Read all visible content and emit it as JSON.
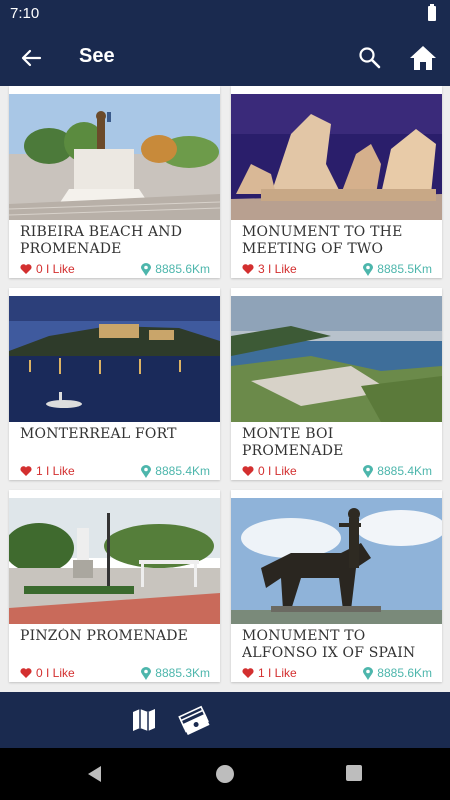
{
  "status_bar": {
    "time": "7:10"
  },
  "app_bar": {
    "title": "See",
    "back_icon": "arrow-back-icon",
    "search_icon": "search-icon",
    "home_icon": "home-icon"
  },
  "cards": [
    {
      "title": "RIBEIRA BEACH AND PROMENADE",
      "likes": "0 I Like",
      "distance": "8885.6Km",
      "image": "statue-with-trees-photo"
    },
    {
      "title": "MONUMENT TO THE MEETING OF TWO",
      "likes": "3 I Like",
      "distance": "8885.5Km",
      "image": "stone-sculpture-photo"
    },
    {
      "title": "MONTERREAL FORT",
      "likes": "1 I Like",
      "distance": "8885.4Km",
      "image": "fort-harbor-night-photo"
    },
    {
      "title": "MONTE BOI PROMENADE",
      "likes": "0 I Like",
      "distance": "8885.4Km",
      "image": "coastal-cliffs-photo"
    },
    {
      "title": "PINZÓN PROMENADE",
      "likes": "0 I Like",
      "distance": "8885.3Km",
      "image": "park-statue-photo"
    },
    {
      "title": "MONUMENT TO ALFONSO IX OF SPAIN",
      "likes": "1 I Like",
      "distance": "8885.6Km",
      "image": "horse-statue-photo"
    }
  ],
  "bottom_bar": {
    "map_icon": "map-icon",
    "bills_icon": "money-icon"
  },
  "colors": {
    "primary": "#1a2a4f",
    "like": "#d32f2f",
    "distance": "#4db6ac"
  }
}
